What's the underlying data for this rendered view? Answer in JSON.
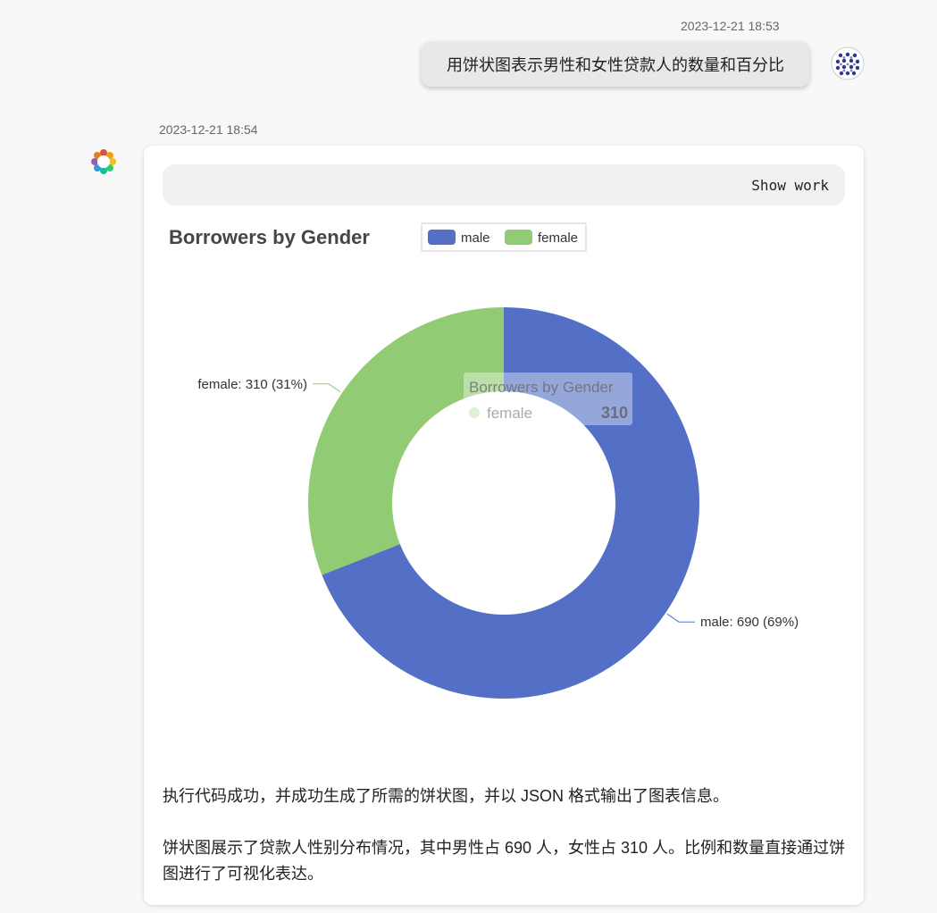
{
  "user_message": {
    "timestamp": "2023-12-21 18:53",
    "text": "用饼状图表示男性和女性贷款人的数量和百分比"
  },
  "bot_message": {
    "timestamp": "2023-12-21 18:54",
    "show_work_label": "Show work",
    "paragraphs": [
      "执行代码成功，并成功生成了所需的饼状图，并以 JSON 格式输出了图表信息。",
      "饼状图展示了贷款人性别分布情况，其中男性占 690 人，女性占 310 人。比例和数量直接通过饼图进行了可视化表达。"
    ]
  },
  "chart_data": {
    "type": "pie",
    "donut": true,
    "title": "Borrowers by Gender",
    "legend_position": "top",
    "slices": [
      {
        "name": "male",
        "value": 690,
        "percent": 69,
        "color": "#5470c6",
        "label": "male: 690 (69%)"
      },
      {
        "name": "female",
        "value": 310,
        "percent": 31,
        "color": "#91cc75",
        "label": "female: 310 (31%)"
      }
    ],
    "tooltip": {
      "title": "Borrowers by Gender",
      "series": "female",
      "value": "310"
    }
  }
}
